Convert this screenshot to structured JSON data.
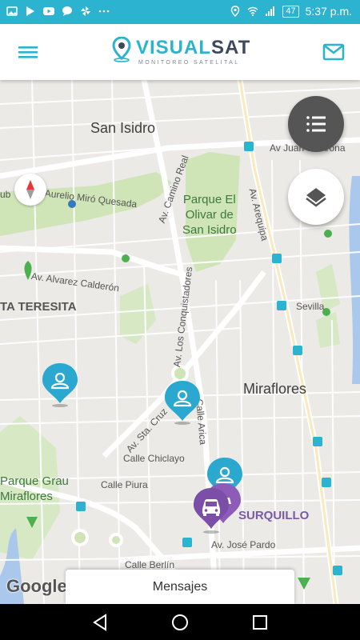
{
  "status_bar": {
    "battery": "47",
    "time": "5:37 p.m.",
    "left_icons": [
      "gallery-icon",
      "play-icon",
      "youtube-icon",
      "chat-icon",
      "pinwheel-icon",
      "more-dots-icon"
    ],
    "right_icons": [
      "location-icon",
      "wifi-icon",
      "signal-icon",
      "battery-icon"
    ]
  },
  "app_bar": {
    "brand_part1": "VISUAL",
    "brand_part2": "SAT",
    "tagline": "MONITOREO SATELITAL",
    "menu_icon": "menu-icon",
    "mail_icon": "mail-icon"
  },
  "map": {
    "labels": {
      "san_isidro": "San Isidro",
      "av_juan": "Av Juan de Arona",
      "av_aurelio": "Av. Aurelio Miró Quesada",
      "av_camino": "Av. Camino Real",
      "parque_olivar": "Parque El\nOlivar de\nSan Isidro",
      "av_arequipa": "Av. Arequipa",
      "av_alvarez": "Av. Alvarez Calderón",
      "santa_teresita": "TA TERESITA",
      "av_conquistadores": "Av. Los Conquistadores",
      "sevilla": "Sevilla",
      "miraflores": "Miraflores",
      "calle_arica": "Calle Arica",
      "av_sta_cruz": "Av. Sta. Cruz",
      "calle_chiclayo": "Calle Chiclayo",
      "parque_grau": "Parque Grau\nMiraflores",
      "calle_piura": "Calle Piura",
      "surquillo": "SURQUILLO",
      "av_jose_pardo": "Av. José Pardo",
      "calle_berlin": "Calle Berlín",
      "ub": "ub"
    },
    "google": "Google"
  },
  "controls": {
    "list_icon": "list-icon",
    "layers_icon": "layers-icon",
    "compass_icon": "compass-icon",
    "messages_label": "Mensajes"
  },
  "colors": {
    "accent": "#2bb3cf",
    "marker_person": "#2aa8cf",
    "marker_vehicle": "#7b4ea8",
    "park": "#cfe5b8",
    "road": "#ffffff"
  }
}
